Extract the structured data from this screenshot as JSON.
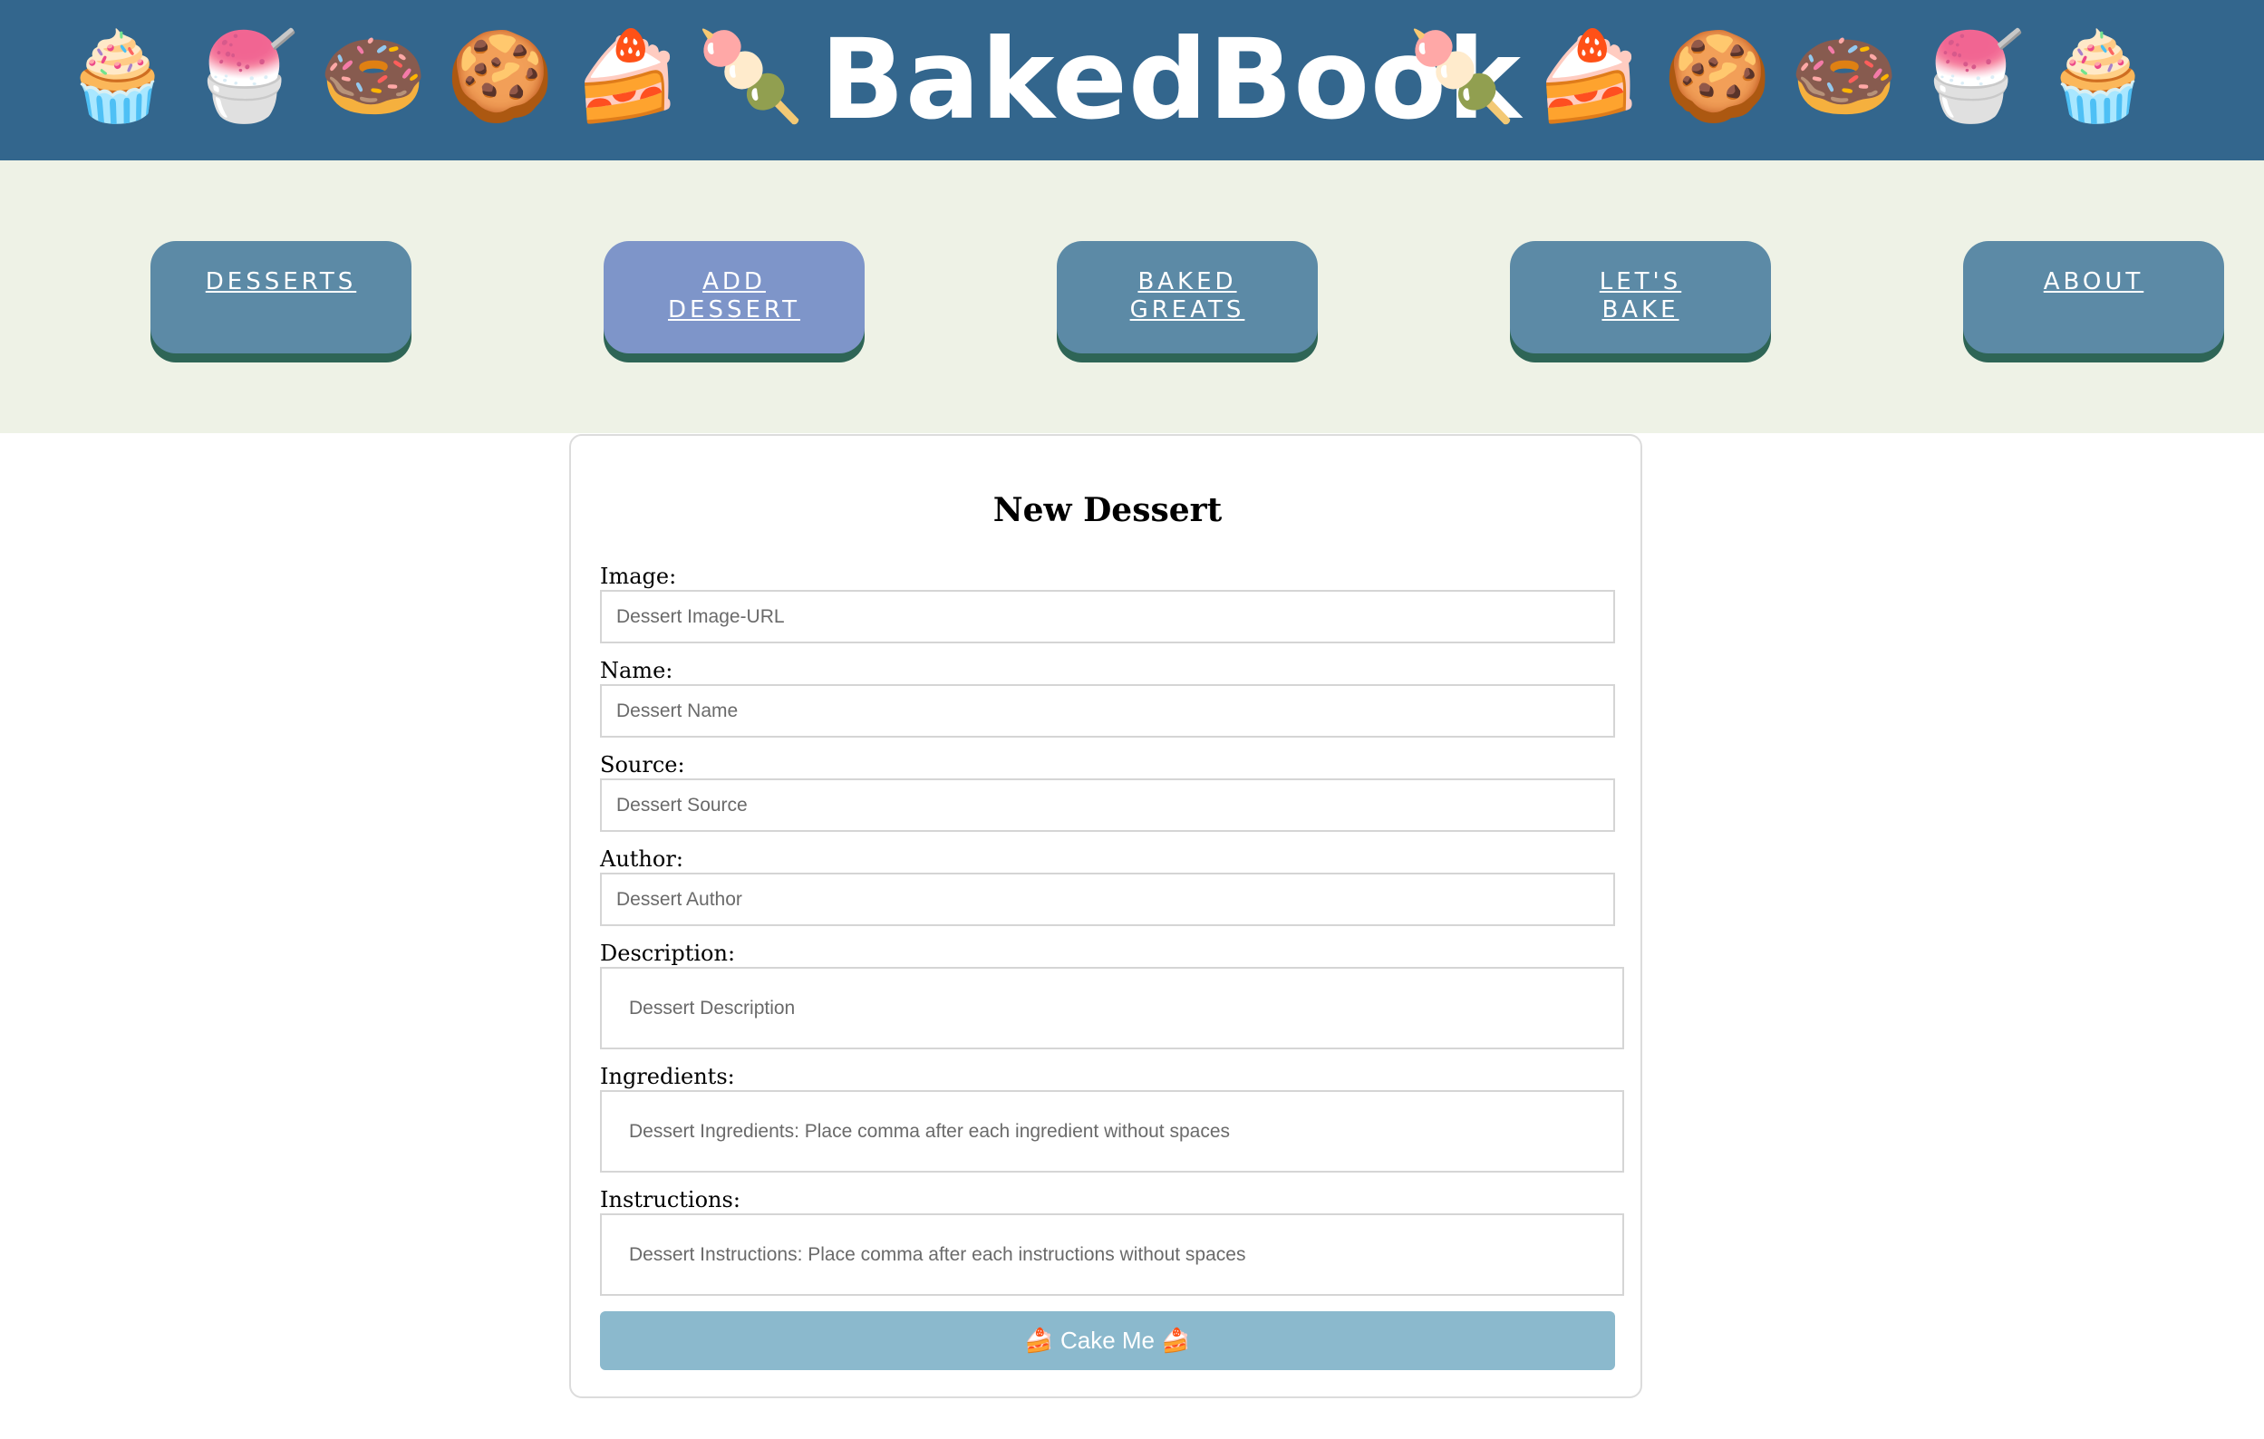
{
  "header": {
    "brand": "BakedBook",
    "emojis_left": [
      "🧁",
      "🍧",
      "🍩",
      "🍪",
      "🍰",
      "🍡"
    ],
    "emojis_right": [
      "🍡",
      "🍰",
      "🍪",
      "🍩",
      "🍧",
      "🧁"
    ]
  },
  "nav": {
    "items": [
      {
        "label": "Desserts",
        "active": false
      },
      {
        "label": "Add Dessert",
        "active": true
      },
      {
        "label": "Baked Greats",
        "active": false
      },
      {
        "label": "Let's Bake",
        "active": false
      },
      {
        "label": "About",
        "active": false
      }
    ]
  },
  "form": {
    "title": "New Dessert",
    "fields": [
      {
        "label": "Image:",
        "placeholder": "Dessert Image-URL"
      },
      {
        "label": "Name:",
        "placeholder": "Dessert Name"
      },
      {
        "label": "Source:",
        "placeholder": "Dessert Source"
      },
      {
        "label": "Author:",
        "placeholder": "Dessert Author"
      },
      {
        "label": "Description:",
        "placeholder": "Dessert Description"
      },
      {
        "label": "Ingredients:",
        "placeholder": "Dessert Ingredients:  Place comma after each ingredient without spaces"
      },
      {
        "label": "Instructions:",
        "placeholder": "Dessert Instructions: Place comma after each instructions without spaces"
      }
    ],
    "submit_label": "🍰 Cake Me 🍰"
  },
  "colors": {
    "header_bg": "#33668d",
    "nav_bg": "#eef2e6",
    "nav_button": "#5c8aa6",
    "nav_button_active": "#7e95c9",
    "nav_button_shadow": "#2e6556",
    "submit_bg": "#8bb9cd"
  }
}
